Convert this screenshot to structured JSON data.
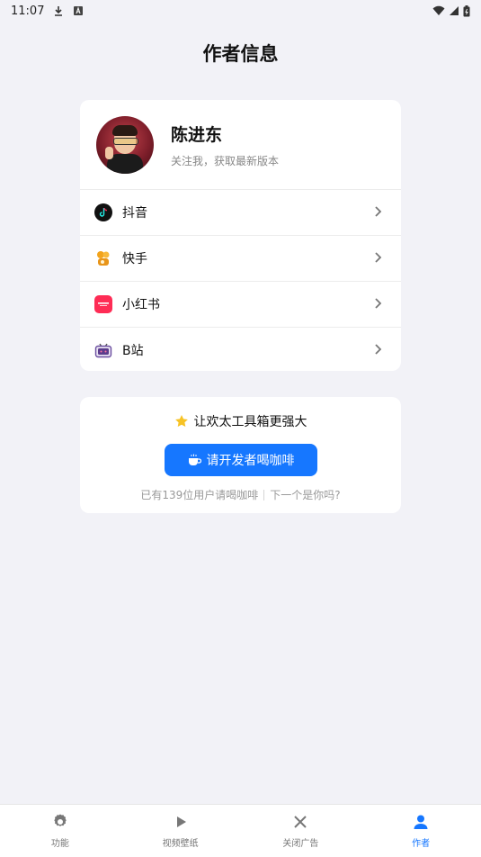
{
  "status": {
    "time": "11:07"
  },
  "page": {
    "title": "作者信息"
  },
  "profile": {
    "name": "陈进东",
    "subtitle": "关注我，获取最新版本"
  },
  "links": [
    {
      "label": "抖音",
      "icon": "douyin-icon"
    },
    {
      "label": "快手",
      "icon": "kuaishou-icon"
    },
    {
      "label": "小红书",
      "icon": "xiaohongshu-icon"
    },
    {
      "label": "B站",
      "icon": "bilibili-icon"
    }
  ],
  "coffee": {
    "title": "让欢太工具箱更强大",
    "button_label": "请开发者喝咖啡",
    "count_text": "已有139位用户请喝咖啡",
    "next_text": "下一个是你吗?"
  },
  "tabs": [
    {
      "label": "功能",
      "icon": "gear-icon",
      "active": false
    },
    {
      "label": "视频壁纸",
      "icon": "play-icon",
      "active": false
    },
    {
      "label": "关闭广告",
      "icon": "close-icon",
      "active": false
    },
    {
      "label": "作者",
      "icon": "person-icon",
      "active": true
    }
  ],
  "colors": {
    "accent": "#1677ff",
    "background": "#f2f2f7"
  }
}
